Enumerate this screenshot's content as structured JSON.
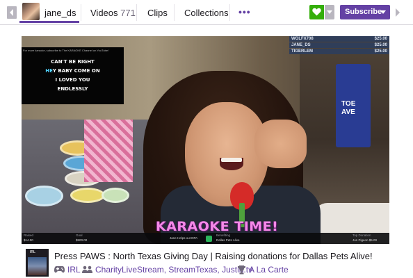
{
  "channel": {
    "name": "jane_ds"
  },
  "tabs": [
    {
      "label": "Videos",
      "count": "771"
    },
    {
      "label": "Clips"
    },
    {
      "label": "Collections"
    }
  ],
  "more_menu": {
    "icon": "more-dots-icon",
    "label": "•••"
  },
  "actions": {
    "follow_icon": "heart-icon",
    "subscribe_label": "Subscribe",
    "colors": {
      "follow": "#34ae0a",
      "subscribe": "#6441a4"
    }
  },
  "player": {
    "lyrics": {
      "header": "For more karaoke, subscribe to The KARAOKE Channel on YouTube!",
      "lines": [
        {
          "sung": "",
          "rest": "CAN'T BE RIGHT"
        },
        {
          "sung": "HE",
          "rest": "Y BABY COME ON"
        },
        {
          "sung": "",
          "rest": "I LOVED YOU"
        },
        {
          "sung": "",
          "rest": "ENDLESSLY"
        }
      ]
    },
    "leaderboard": [
      {
        "name": "WOLFX708",
        "value": "$25.00"
      },
      {
        "name": "JANE_DS",
        "value": "$25.00"
      },
      {
        "name": "TIGERLEM",
        "value": "$25.00"
      }
    ],
    "flag_text": "TOE\nAVE",
    "banner": "KARAOKE TIME!",
    "bottom_bar": {
      "raised_label": "Raised",
      "raised_value": "$14.00",
      "goal_label": "Goal",
      "goal_value": "$500.00",
      "helper_text": "Jane Helps out DPA",
      "benefiting_label": "Benefiting",
      "benefiting_value": "Dallas Pets Alive",
      "top_donation_label": "Top Donation",
      "top_donation_value": "Jon Pigeon $5.00"
    }
  },
  "video_info": {
    "thumb_label": "IRL",
    "title": "Press PAWS : North Texas Giving Day | Raising donations for Dallas Pets Alive!",
    "game": "IRL",
    "communities": "CharityLiveStream, StreamTexas, Justin.tv",
    "extra": "A La Carte"
  }
}
